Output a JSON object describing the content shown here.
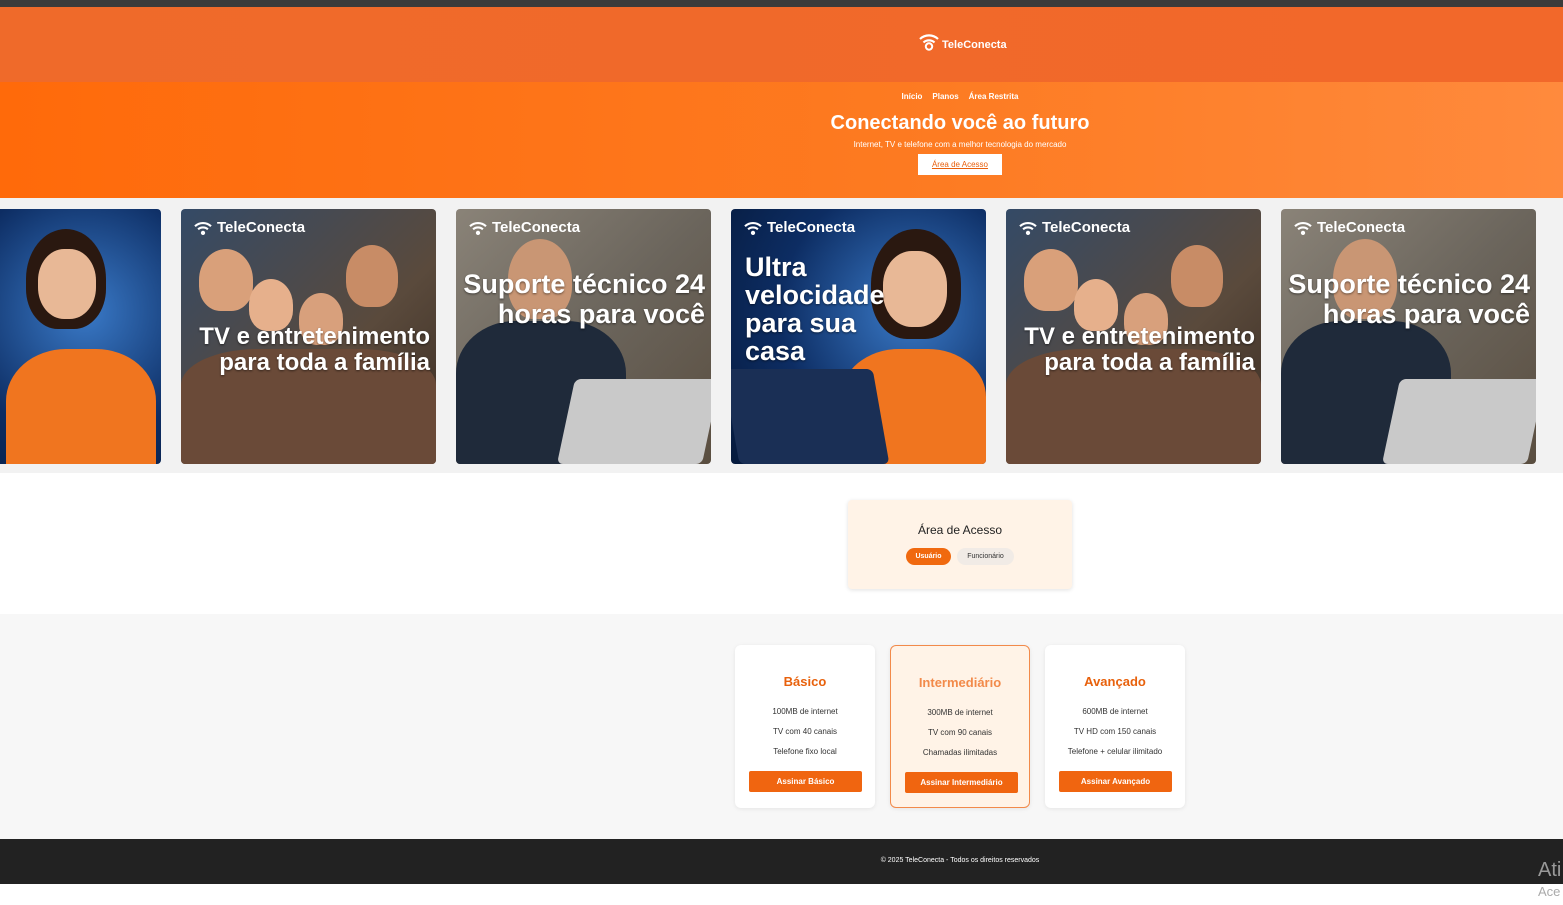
{
  "brand": {
    "name": "TeleConecta",
    "color_primary": "#f0690f",
    "icon": "wifi-icon"
  },
  "nav": {
    "items": [
      "Início",
      "Planos",
      "Área Restrita"
    ]
  },
  "hero": {
    "title": "Conectando você ao futuro",
    "subtitle": "Internet, TV e telefone com a melhor tecnologia do mercado",
    "cta": "Área de Acesso"
  },
  "carousel": {
    "slides": [
      {
        "brand": "TeleConecta",
        "caption": "Ultra velocidade para sua casa"
      },
      {
        "brand": "TeleConecta",
        "caption": "TV e entretenimento para toda a família"
      },
      {
        "brand": "TeleConecta",
        "caption": "Suporte técnico 24 horas para você"
      }
    ]
  },
  "access": {
    "title": "Área de Acesso",
    "tabs": [
      "Usuário",
      "Funcionário"
    ],
    "active_tab": "Usuário"
  },
  "plans": [
    {
      "name": "Básico",
      "features": [
        "100MB de internet",
        "TV com 40 canais",
        "Telefone fixo local"
      ],
      "button": "Assinar Básico",
      "featured": false
    },
    {
      "name": "Intermediário",
      "features": [
        "300MB de internet",
        "TV com 90 canais",
        "Chamadas ilimitadas"
      ],
      "button": "Assinar Intermediário",
      "featured": true
    },
    {
      "name": "Avançado",
      "features": [
        "600MB de internet",
        "TV HD com 150 canais",
        "Telefone + celular ilimitado"
      ],
      "button": "Assinar Avançado",
      "featured": false
    }
  ],
  "footer": {
    "text": "© 2025 TeleConecta - Todos os direitos reservados"
  },
  "os_watermark": {
    "line1": "Ati",
    "line2": "Ace"
  }
}
